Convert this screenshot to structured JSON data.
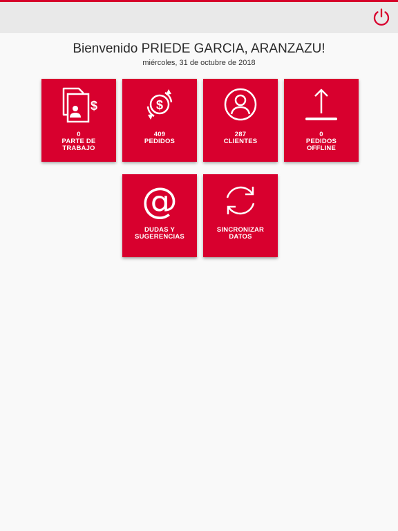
{
  "header": {
    "logout_icon": "power-icon",
    "accent_color": "#d8002e"
  },
  "welcome": {
    "title": "Bienvenido PRIEDE GARCIA, ARANZAZU!",
    "date": "miércoles, 31 de octubre de 2018"
  },
  "tiles": [
    {
      "count": "0",
      "line1": "PARTE DE",
      "line2": "TRABAJO",
      "icon": "work-report-icon"
    },
    {
      "count": "409",
      "line1": "PEDIDOS",
      "line2": "",
      "icon": "money-exchange-icon"
    },
    {
      "count": "287",
      "line1": "CLIENTES",
      "line2": "",
      "icon": "user-icon"
    },
    {
      "count": "0",
      "line1": "PEDIDOS",
      "line2": "OFFLINE",
      "icon": "upload-icon"
    },
    {
      "count": "",
      "line1": "DUDAS Y",
      "line2": "SUGERENCIAS",
      "icon": "at-sign-icon"
    },
    {
      "count": "",
      "line1": "SINCRONIZAR",
      "line2": "DATOS",
      "icon": "sync-icon"
    }
  ]
}
